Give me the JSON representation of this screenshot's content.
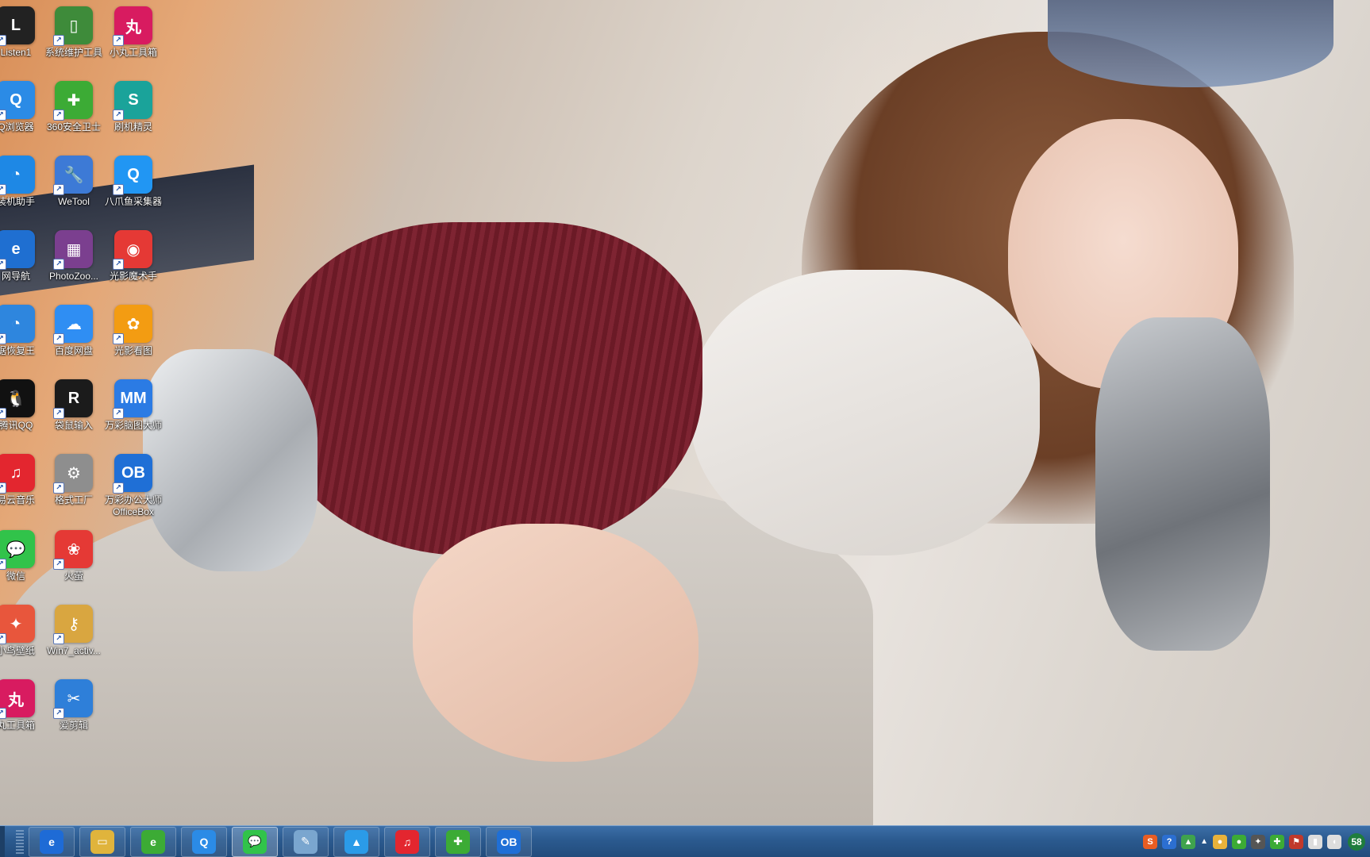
{
  "desktop": {
    "wallpaper": "woman-on-sofa-photo",
    "icons": [
      {
        "label": "Listen1",
        "icon": "listen1-icon",
        "color": "#222222",
        "glyph": "L"
      },
      {
        "label": "系统维护工具",
        "icon": "system-tool-icon",
        "color": "#3e8b3a",
        "glyph": "▯"
      },
      {
        "label": "小丸工具箱",
        "icon": "xiaowan-toolbox-icon",
        "color": "#d81b60",
        "glyph": "丸"
      },
      {
        "label": "Q浏览器",
        "icon": "qq-browser-icon",
        "color": "#2b8be6",
        "glyph": "Q"
      },
      {
        "label": "360安全卫士",
        "icon": "security-360-icon",
        "color": "#3cab35",
        "glyph": "✚"
      },
      {
        "label": "刷机精灵",
        "icon": "shuaji-icon",
        "color": "#1aa39a",
        "glyph": "S"
      },
      {
        "label": "装机助手",
        "icon": "install-helper-icon",
        "color": "#1e88e5",
        "glyph": "◔"
      },
      {
        "label": "WeTool",
        "icon": "wrench-icon",
        "color": "#3d7ad6",
        "glyph": "🔧"
      },
      {
        "label": "八爪鱼采集器",
        "icon": "octopus-collector-icon",
        "color": "#2196f3",
        "glyph": "Q"
      },
      {
        "label": "网导航",
        "icon": "ie-icon",
        "color": "#1f6fd1",
        "glyph": "e"
      },
      {
        "label": "PhotoZoo...",
        "icon": "winrar-icon",
        "color": "#7b3f8f",
        "glyph": "▦"
      },
      {
        "label": "光影魔术手",
        "icon": "guangying-icon",
        "color": "#e53935",
        "glyph": "◉"
      },
      {
        "label": "据恢复王",
        "icon": "data-recovery-icon",
        "color": "#2e86de",
        "glyph": "◔"
      },
      {
        "label": "百度网盘",
        "icon": "baidu-netdisk-icon",
        "color": "#2f8ef3",
        "glyph": "☁"
      },
      {
        "label": "光影看图",
        "icon": "guangying-viewer-icon",
        "color": "#f39c12",
        "glyph": "✿"
      },
      {
        "label": "腾讯QQ",
        "icon": "qq-penguin-icon",
        "color": "#111111",
        "glyph": "🐧"
      },
      {
        "label": "袋鼠输入",
        "icon": "kangaroo-input-icon",
        "color": "#1b1b1b",
        "glyph": "R"
      },
      {
        "label": "万彩脑图大师",
        "icon": "mindmaster-icon",
        "color": "#2b7be4",
        "glyph": "MM"
      },
      {
        "label": "易云音乐",
        "icon": "netease-music-icon",
        "color": "#e3262f",
        "glyph": "♫"
      },
      {
        "label": "格式工厂",
        "icon": "format-factory-icon",
        "color": "#8e8e8e",
        "glyph": "⚙"
      },
      {
        "label": "万彩办公大师\nOfficeBox",
        "icon": "officebox-icon",
        "color": "#1f6fd6",
        "glyph": "OB"
      },
      {
        "label": "微信",
        "icon": "wechat-icon",
        "color": "#31c34a",
        "glyph": "💬"
      },
      {
        "label": "火萤",
        "icon": "firefly-icon",
        "color": "#e53935",
        "glyph": "❀"
      },
      {
        "label": "小鸟壁纸",
        "icon": "bird-wallpaper-icon",
        "color": "#e8563c",
        "glyph": "✦"
      },
      {
        "label": "Win7_activ...",
        "icon": "key-icon",
        "color": "#d9a640",
        "glyph": "⚷"
      },
      {
        "label": "丸工具箱",
        "icon": "xiaowan-toolbox-icon-2",
        "color": "#d81b60",
        "glyph": "丸"
      },
      {
        "label": "爱剪辑",
        "icon": "aijianji-icon",
        "color": "#2e7fd9",
        "glyph": "✂"
      }
    ]
  },
  "taskbar": {
    "buttons": [
      {
        "name": "ie",
        "icon": "ie-icon",
        "color": "#1e6bd6",
        "glyph": "e"
      },
      {
        "name": "explorer",
        "icon": "folder-icon",
        "color": "#e0b43c",
        "glyph": "▭"
      },
      {
        "name": "360-browser",
        "icon": "browser-360-icon",
        "color": "#3cab35",
        "glyph": "e"
      },
      {
        "name": "qq-browser",
        "icon": "qq-browser-icon",
        "color": "#2b8be6",
        "glyph": "Q"
      },
      {
        "name": "wechat",
        "icon": "wechat-icon",
        "color": "#31c34a",
        "glyph": "💬"
      },
      {
        "name": "notepad",
        "icon": "notepad-icon",
        "color": "#7aa6cf",
        "glyph": "✎"
      },
      {
        "name": "maxthon",
        "icon": "mountain-icon",
        "color": "#2b9be8",
        "glyph": "▲"
      },
      {
        "name": "netease-music",
        "icon": "netease-music-icon",
        "color": "#e3262f",
        "glyph": "♫"
      },
      {
        "name": "security-360",
        "icon": "security-360-icon",
        "color": "#3cab35",
        "glyph": "✚"
      },
      {
        "name": "officebox",
        "icon": "officebox-icon",
        "color": "#1f6fd6",
        "glyph": "OB"
      }
    ],
    "tray": {
      "icons": [
        {
          "icon": "sogou-icon",
          "color": "#e85d22",
          "glyph": "S"
        },
        {
          "icon": "help-icon",
          "color": "#2c6fd1",
          "glyph": "?"
        },
        {
          "icon": "network-icon",
          "color": "#3fa34d",
          "glyph": "▲"
        },
        {
          "icon": "chat-tray-icon",
          "color": "#e9b23b",
          "glyph": "●"
        },
        {
          "icon": "green-tray-icon",
          "color": "#3cab35",
          "glyph": "●"
        },
        {
          "icon": "bat-tray-icon",
          "color": "#555555",
          "glyph": "✦"
        },
        {
          "icon": "plus-tray-icon",
          "color": "#3cab35",
          "glyph": "✚"
        },
        {
          "icon": "flag-tray-icon",
          "color": "#c0392b",
          "glyph": "⚑"
        },
        {
          "icon": "signal-icon",
          "color": "#dddddd",
          "glyph": "▮"
        },
        {
          "icon": "volume-icon",
          "color": "#dddddd",
          "glyph": "◖"
        }
      ],
      "clock_badge": "58"
    }
  }
}
